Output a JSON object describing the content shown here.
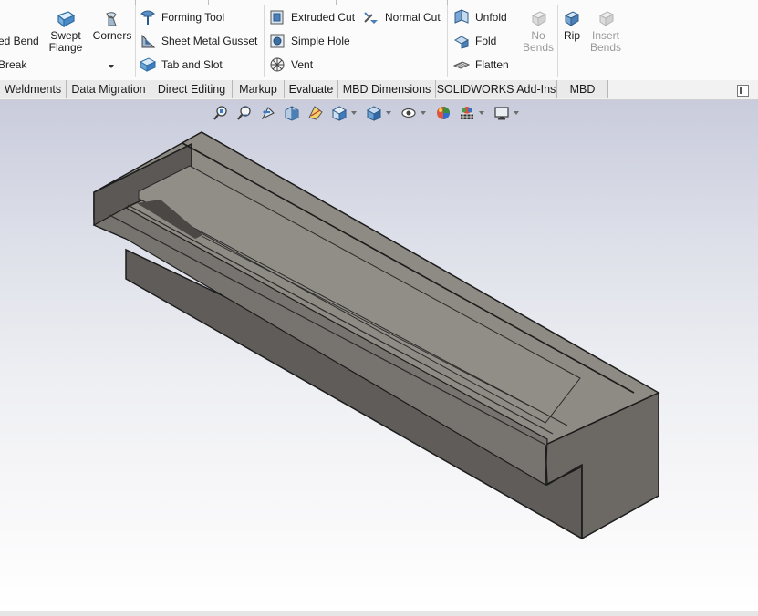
{
  "ribbon": {
    "col1": {
      "row1": "ed Bend",
      "row3": "Break"
    },
    "swept_flange": {
      "line1": "Swept",
      "line2": "Flange"
    },
    "corners": {
      "label": "Corners"
    },
    "col3": {
      "forming_tool": "Forming Tool",
      "sheet_metal_gusset": "Sheet Metal Gusset",
      "tab_and_slot": "Tab and Slot"
    },
    "col4": {
      "extruded_cut": "Extruded Cut",
      "simple_hole": "Simple Hole",
      "vent": "Vent",
      "normal_cut": "Normal Cut"
    },
    "col5": {
      "unfold": "Unfold",
      "fold": "Fold",
      "flatten": "Flatten"
    },
    "no_bends": {
      "line1": "No",
      "line2": "Bends"
    },
    "rip": {
      "label": "Rip"
    },
    "insert_bends": {
      "line1": "Insert",
      "line2": "Bends"
    }
  },
  "tabs": [
    "Weldments",
    "Data Migration",
    "Direct Editing",
    "Markup",
    "Evaluate",
    "MBD Dimensions",
    "SOLIDWORKS Add-Ins",
    "MBD"
  ],
  "hud_icons": [
    "zoom-to-fit-icon",
    "zoom-to-area-icon",
    "previous-view-icon",
    "section-view-icon",
    "dynamic-annotation-icon",
    "view-orientation-icon",
    "display-style-icon",
    "hide-show-items-icon",
    "edit-appearance-icon",
    "apply-scene-icon",
    "view-settings-icon"
  ],
  "colors": {
    "model_top": "#8f8b85",
    "model_side": "#6d6a66",
    "model_front": "#5f5c59",
    "viewport_top": "#c9ccdc",
    "accent": "#1f6fb4"
  }
}
